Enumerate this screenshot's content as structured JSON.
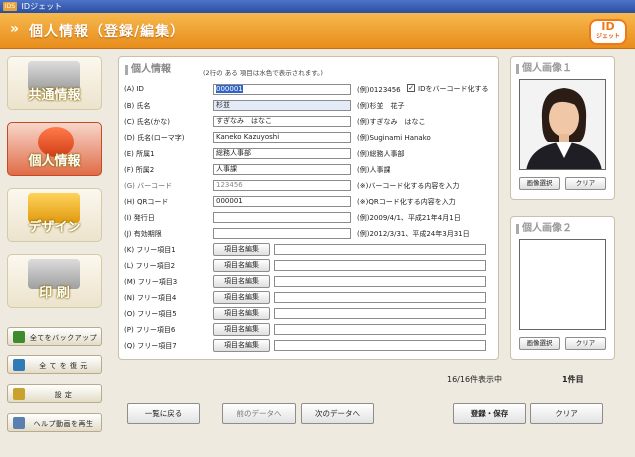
{
  "window": {
    "title": "IDジェット",
    "icon_text": "IDS"
  },
  "header": {
    "title": "個人情報（登録/編集）",
    "logo_top": "ID",
    "logo_bottom": "ジェット"
  },
  "sidebar": {
    "nav": [
      {
        "label": "共通情報"
      },
      {
        "label": "個人情報"
      },
      {
        "label": "デザイン"
      },
      {
        "label": "印 刷"
      }
    ],
    "actions": [
      {
        "label": "全てをバックアップ",
        "icon_color": "#3e8a2e"
      },
      {
        "label": "全 て を 復 元",
        "icon_color": "#2e7bb8"
      },
      {
        "label": "設 定",
        "icon_color": "#c9a22e"
      },
      {
        "label": "ヘルプ動画を再生",
        "icon_color": "#5a7fb0"
      }
    ]
  },
  "form": {
    "title": "個人情報",
    "note": "(2行の ある 項目は水色で表示されます。)",
    "barcode_option": {
      "checked": true,
      "label": "IDをバーコード化する"
    },
    "rows": [
      {
        "label": "(A) ID",
        "value": "000001",
        "example": "(例)0123456",
        "width": 138
      },
      {
        "label": "(B) 氏名",
        "value": "杉並",
        "example": "(例)杉並　花子",
        "width": 138
      },
      {
        "label": "(C) 氏名(かな)",
        "value": "すぎなみ　はなこ",
        "example": "(例)すぎなみ　はなこ",
        "width": 138
      },
      {
        "label": "(D) 氏名(ローマ字)",
        "value": "Kaneko Kazuyoshi",
        "example": "(例)Suginami Hanako",
        "width": 138
      },
      {
        "label": "(E) 所属1",
        "value": "総務人事部",
        "example": "(例)総務人事部",
        "width": 138
      },
      {
        "label": "(F) 所属2",
        "value": "人事課",
        "example": "(例)人事課",
        "width": 138
      },
      {
        "label": "(G) バーコード",
        "value": "123456",
        "example": "(※)バーコード化する内容を入力",
        "width": 138
      },
      {
        "label": "(H) QRコード",
        "value": "000001",
        "example": "(※)QRコード化する内容を入力",
        "width": 138
      },
      {
        "label": "(I) 発行日",
        "value": "",
        "example": "(例)2009/4/1、平成21年4月1日",
        "width": 138
      },
      {
        "label": "(J) 有効期限",
        "value": "",
        "example": "(例)2012/3/31、平成24年3月31日",
        "width": 138
      }
    ],
    "free_rows": [
      {
        "label": "(K) フリー項目1",
        "button": "項目名編集",
        "value": ""
      },
      {
        "label": "(L) フリー項目2",
        "button": "項目名編集",
        "value": ""
      },
      {
        "label": "(M) フリー項目3",
        "button": "項目名編集",
        "value": ""
      },
      {
        "label": "(N) フリー項目4",
        "button": "項目名編集",
        "value": ""
      },
      {
        "label": "(O) フリー項目5",
        "button": "項目名編集",
        "value": ""
      },
      {
        "label": "(P) フリー項目6",
        "button": "項目名編集",
        "value": ""
      },
      {
        "label": "(Q) フリー項目7",
        "button": "項目名編集",
        "value": ""
      }
    ]
  },
  "photos": [
    {
      "title": "個人画像１",
      "select_label": "画像選択",
      "clear_label": "クリア",
      "has_image": true
    },
    {
      "title": "個人画像２",
      "select_label": "画像選択",
      "clear_label": "クリア",
      "has_image": false
    }
  ],
  "status": {
    "count_text": "16/16件表示中",
    "current_text": "1件目"
  },
  "footer": {
    "back": "一覧に戻る",
    "prev": "前のデータへ",
    "next": "次のデータへ",
    "save": "登録・保存",
    "clear": "クリア"
  }
}
